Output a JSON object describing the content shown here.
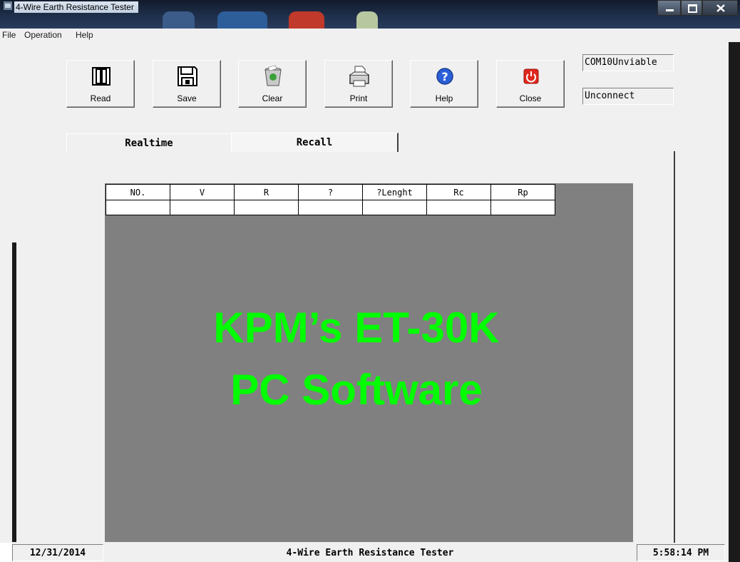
{
  "window": {
    "title": "4-Wire Earth Resistance Tester"
  },
  "menu": [
    "File",
    "Operation",
    "Help"
  ],
  "toolbar": {
    "read_label": "Read",
    "save_label": "Save",
    "clear_label": "Clear",
    "print_label": "Print",
    "help_label": "Help",
    "close_label": "Close"
  },
  "status_panel": {
    "com_port": "COM10Unviable",
    "connection": "Unconnect"
  },
  "tabs": [
    "Realtime",
    "Recall"
  ],
  "table": {
    "headers": [
      "NO.",
      "V",
      "R",
      "?",
      "?Lenght",
      "Rc",
      "Rp"
    ]
  },
  "overlay": {
    "line1": "KPM’s ET-30K",
    "line2": "PC Software"
  },
  "statusbar": {
    "date": "12/31/2014",
    "title": "4-Wire Earth Resistance Tester",
    "time": "5:58:14 PM"
  },
  "colors": {
    "overlay_text": "#00ff00",
    "grid_background": "#808080"
  }
}
